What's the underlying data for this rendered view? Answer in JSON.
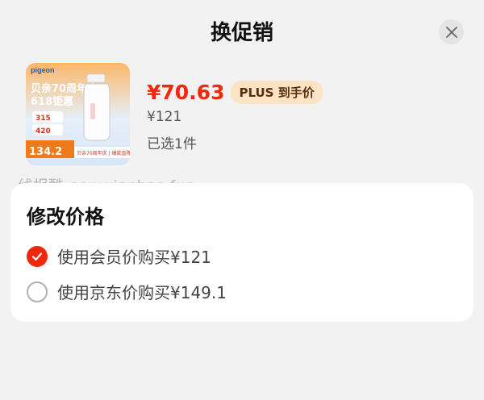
{
  "header": {
    "title": "换促销",
    "close_icon": "close-icon"
  },
  "product": {
    "image": {
      "brand": "Pigeon",
      "banner_line1": "贝亲70周年庆",
      "banner_line2": "618钜惠",
      "price_tag_1": "315",
      "price_tag_2": "420",
      "final_price": "134.2",
      "footer_text": "贝亲70周年庆 | 爆款直降"
    },
    "price": "¥70.63",
    "plus_badge": "PLUS 到手价",
    "original_price": "¥121",
    "selected_text": "已选1件"
  },
  "watermark": "线报酷-new.xianbao.fun",
  "price_section": {
    "title": "修改价格",
    "options": [
      {
        "label": "使用会员价购买¥121",
        "checked": true
      },
      {
        "label": "使用京东价购买¥149.1",
        "checked": false
      }
    ]
  },
  "colors": {
    "accent": "#f2270c",
    "plus_badge_bg": "#fbe3c4",
    "background": "#f2f2f2"
  }
}
